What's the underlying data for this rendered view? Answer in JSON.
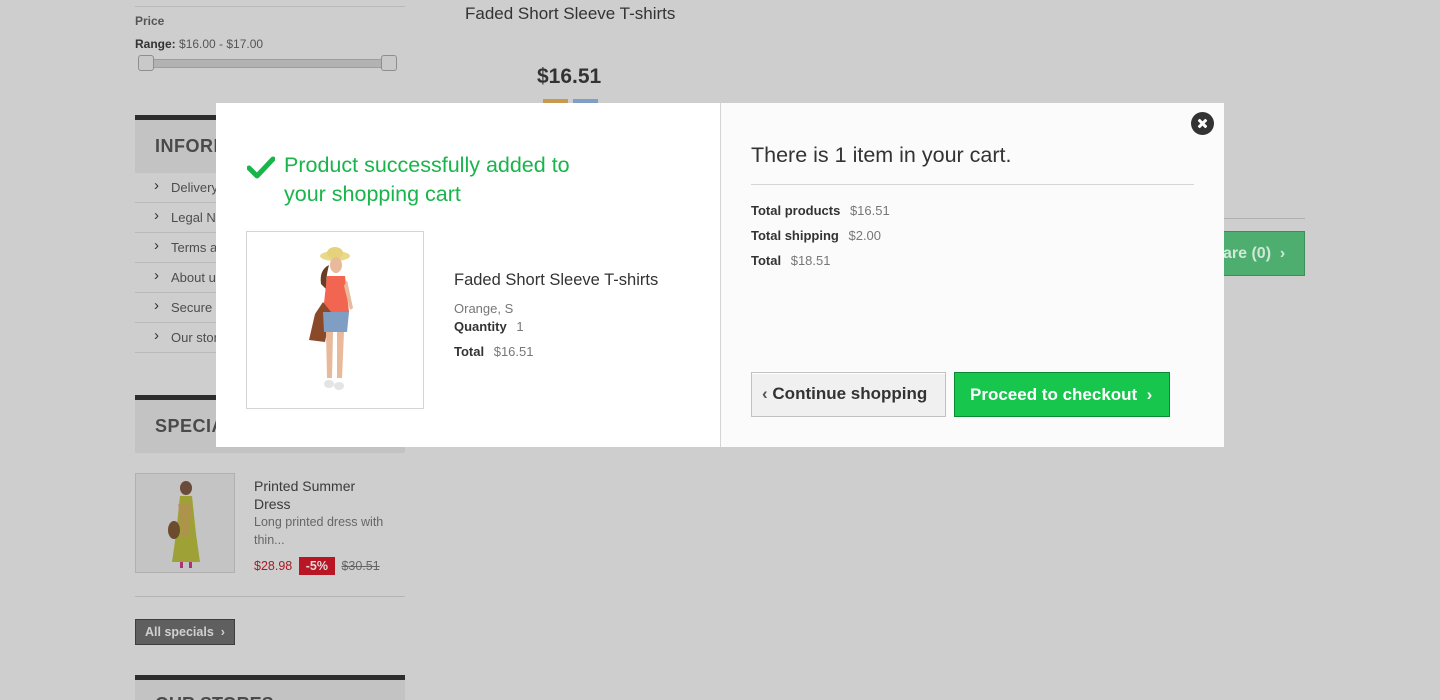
{
  "background": {
    "price_filter": {
      "title": "Price",
      "range_label": "Range:",
      "range_value": "$16.00 - $17.00"
    },
    "information": {
      "heading": "INFORM",
      "items": [
        "Delivery",
        "Legal N",
        "Terms a",
        "About u",
        "Secure",
        "Our stor"
      ]
    },
    "specials": {
      "heading": "SPECIA",
      "item_name": "Printed Summer Dress",
      "item_desc": "Long printed dress with thin...",
      "price": "$28.98",
      "discount": "-5%",
      "old_price": "$30.51",
      "all_button": "All specials"
    },
    "stores": {
      "heading": "OUR STORES"
    },
    "product_title": "Faded Short Sleeve T-shirts",
    "product_price": "$16.51",
    "compare_button": "are (0)",
    "colors": {
      "swatch_orange": "#f39c11",
      "swatch_blue": "#5d9cec"
    }
  },
  "modal": {
    "success_message": "Product successfully added to your shopping cart",
    "product": {
      "name": "Faded Short Sleeve T-shirts",
      "attributes": "Orange, S",
      "quantity_label": "Quantity",
      "quantity_value": "1",
      "total_label": "Total",
      "total_value": "$16.51"
    },
    "cart": {
      "title": "There is 1 item in your cart.",
      "total_products_label": "Total products",
      "total_products_value": "$16.51",
      "total_shipping_label": "Total shipping",
      "total_shipping_value": "$2.00",
      "total_label": "Total",
      "total_value": "$18.51"
    },
    "continue_button": "Continue shopping",
    "checkout_button": "Proceed to checkout",
    "colors": {
      "success_green": "#19b54b",
      "checkout_green": "#17c64c"
    }
  }
}
